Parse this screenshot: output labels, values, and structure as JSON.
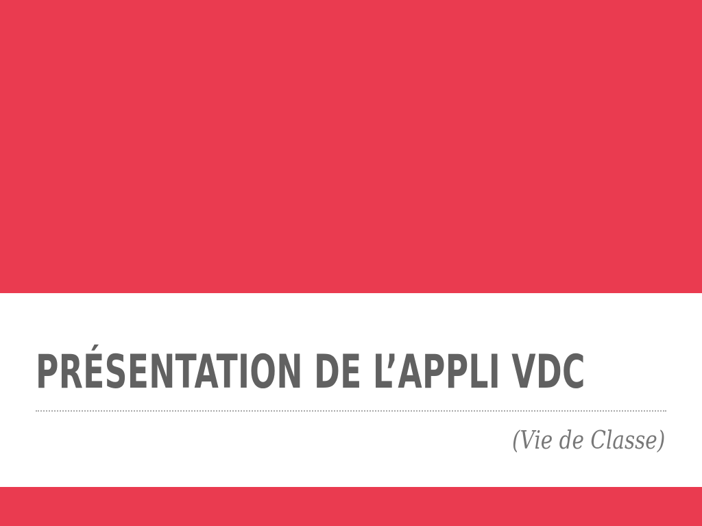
{
  "slide": {
    "title": "PRÉSENTATION DE L’APPLI VDC",
    "subtitle": "(Vie de Classe)"
  },
  "colors": {
    "accent": "#ea3b50",
    "background": "#ffffff",
    "title_text": "#616161",
    "subtitle_text": "#777777",
    "divider": "#a8a8a8"
  }
}
